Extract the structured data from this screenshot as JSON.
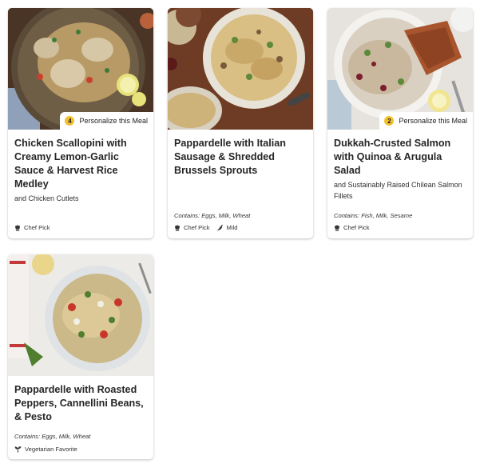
{
  "meals": [
    {
      "title": "Chicken Scallopini with Creamy Lemon-Garlic Sauce & Harvest Rice Medley",
      "subtitle": "and Chicken Cutlets",
      "contains": "",
      "personalize": {
        "count": "4",
        "label": "Personalize this Meal"
      },
      "tags": [
        {
          "icon": "chef-hat-icon",
          "label": "Chef Pick"
        }
      ]
    },
    {
      "title": "Pappardelle with Italian Sausage & Shredded Brussels Sprouts",
      "subtitle": "",
      "contains": "Contains: Eggs, Milk, Wheat",
      "personalize": null,
      "tags": [
        {
          "icon": "chef-hat-icon",
          "label": "Chef Pick"
        },
        {
          "icon": "chili-pepper-icon",
          "label": "Mild"
        }
      ]
    },
    {
      "title": "Dukkah-Crusted Salmon with Quinoa & Arugula Salad",
      "subtitle": "and Sustainably Raised Chilean Salmon Fillets",
      "contains": "Contains: Fish, Milk, Sesame",
      "personalize": {
        "count": "2",
        "label": "Personalize this Meal"
      },
      "tags": [
        {
          "icon": "chef-hat-icon",
          "label": "Chef Pick"
        }
      ]
    },
    {
      "title": "Pappardelle with Roasted Peppers, Cannellini Beans, & Pesto",
      "subtitle": "",
      "contains": "Contains: Eggs, Milk, Wheat",
      "personalize": null,
      "tags": [
        {
          "icon": "sprout-icon",
          "label": "Vegetarian Favorite"
        }
      ]
    }
  ],
  "colors": {
    "badge_accent": "#f2c12e",
    "card_bg": "#ffffff",
    "text": "#262626"
  }
}
